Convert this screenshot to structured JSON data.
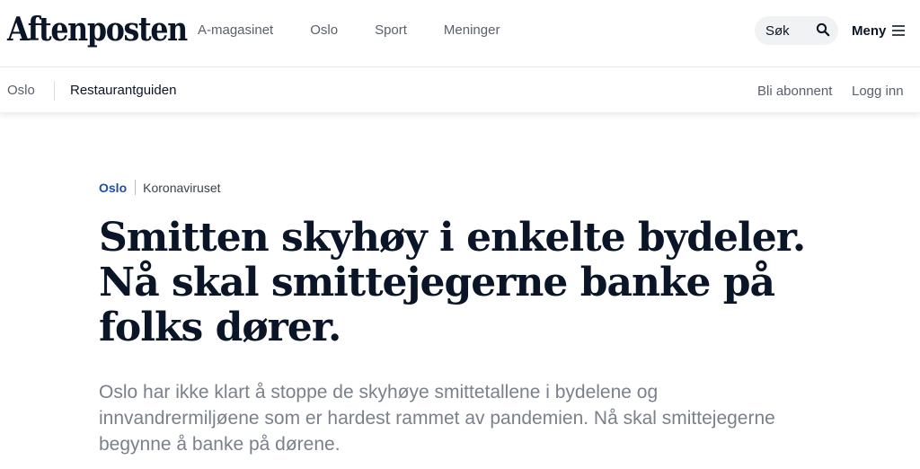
{
  "header": {
    "logo_text": "Aftenposten",
    "nav_items": [
      {
        "label": "A-magasinet"
      },
      {
        "label": "Oslo"
      },
      {
        "label": "Sport"
      },
      {
        "label": "Meninger"
      }
    ],
    "search": {
      "placeholder": "Søk",
      "icon": "search-icon"
    },
    "menu": {
      "label": "Meny",
      "icon": "hamburger-icon"
    }
  },
  "subnav": {
    "section": "Oslo",
    "active_item": "Restaurantguiden",
    "subscribe": "Bli abonnent",
    "login": "Logg inn"
  },
  "article": {
    "kicker_section": "Oslo",
    "kicker_topic": "Koronaviruset",
    "headline": "Smitten skyhøy i enkelte bydeler. Nå skal smittejegerne banke på folks dører.",
    "lead": "Oslo har ikke klart å stoppe de skyhøye smittetallene i bydelene og innvandrermiljøene som er hardest rammet av pandemien. Nå skal smittejegerne begynne å banke på dørene."
  },
  "colors": {
    "text": "#0b1528",
    "muted": "#59606b",
    "accent": "#1e4ea8",
    "search_bg": "#f1f2f3"
  }
}
